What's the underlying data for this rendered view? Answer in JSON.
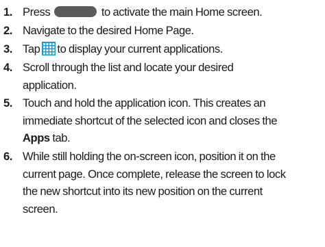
{
  "steps": [
    {
      "number": "1.",
      "before": "Press",
      "after": "to activate the main Home screen.",
      "icon": "home-key-icon",
      "icon_color": "#5a5a5a"
    },
    {
      "number": "2.",
      "text": "Navigate to the desired Home Page."
    },
    {
      "number": "3.",
      "before": "Tap",
      "after": "to display your current applications.",
      "icon": "apps-grid-icon",
      "icon_color": "#0f9fd6"
    },
    {
      "number": "4.",
      "line1": "Scroll through the list and locate your desired",
      "line2": "application."
    },
    {
      "number": "5.",
      "line1": "Touch and hold the application icon. This creates an",
      "line2": "immediate shortcut of the selected icon and closes the",
      "line3_bold": "Apps",
      "line3_rest": " tab."
    },
    {
      "number": "6.",
      "line1": "While still holding the on-screen icon, position it on the",
      "line2": "current page. Once complete, release the screen to lock",
      "line3": "the new shortcut into its new position on the current",
      "line4": "screen."
    }
  ]
}
